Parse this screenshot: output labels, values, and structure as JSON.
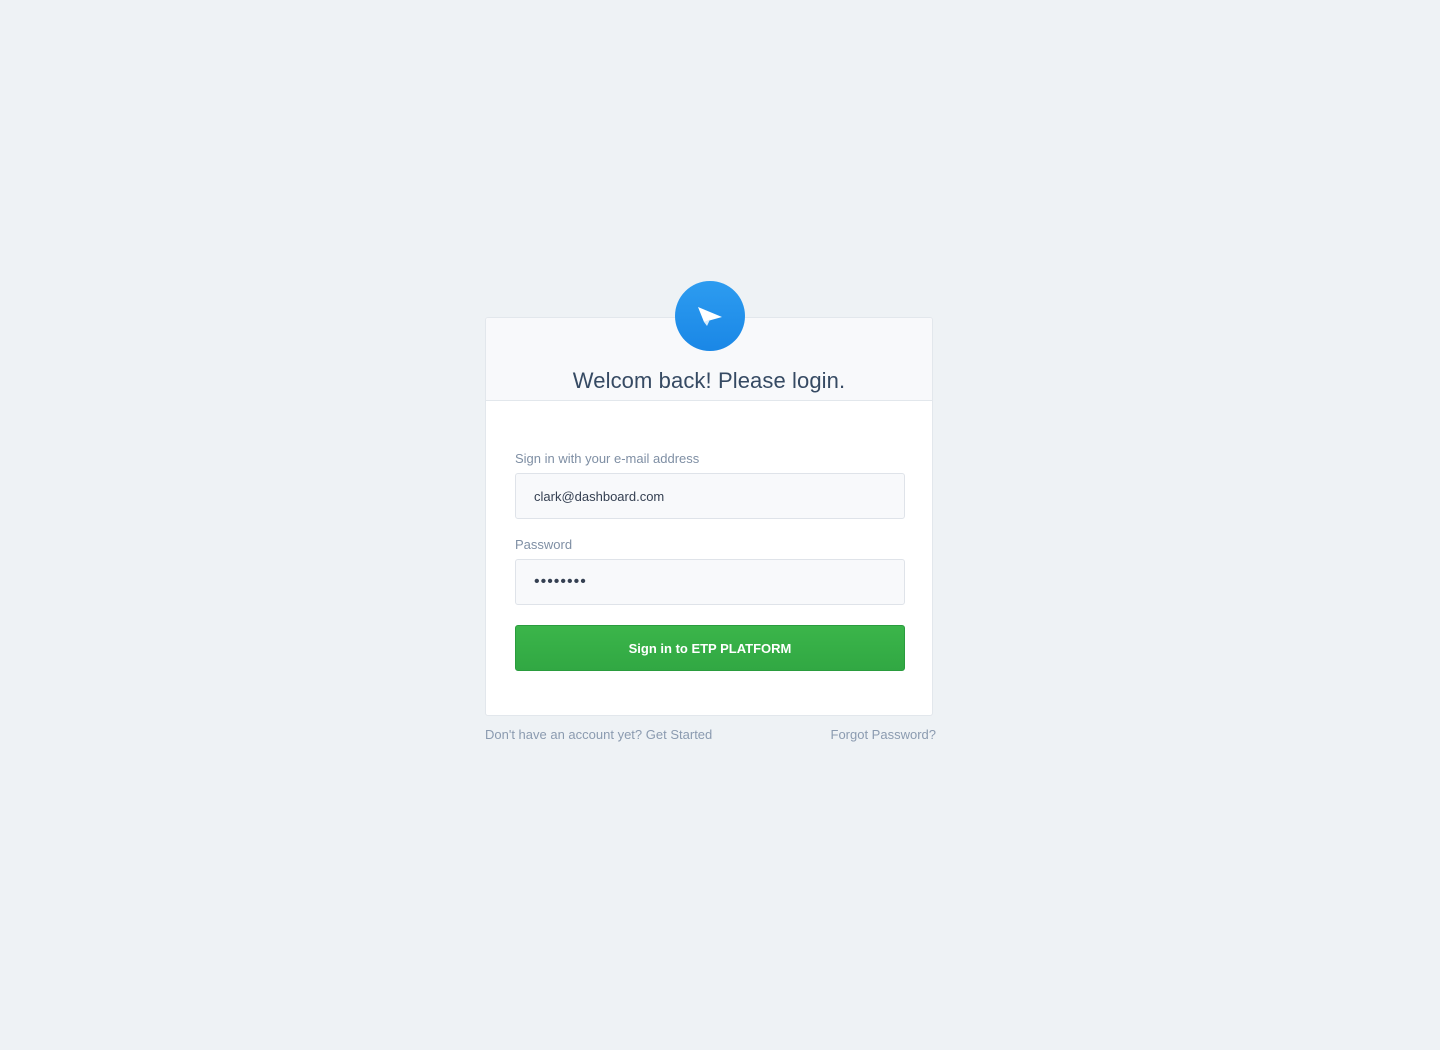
{
  "header": {
    "title": "Welcom back! Please login."
  },
  "logo": {
    "icon": "paper-plane-icon",
    "color": "#2196f3"
  },
  "form": {
    "email_label": "Sign in with your e-mail address",
    "email_value": "clark@dashboard.com",
    "password_label": "Password",
    "password_value": "••••••••",
    "submit_label": "Sign in to ETP PLATFORM",
    "submit_color": "#39b54a"
  },
  "footer": {
    "no_account_text": "Don't have an account yet?",
    "get_started_label": "Get Started",
    "forgot_password_label": "Forgot Password?"
  }
}
